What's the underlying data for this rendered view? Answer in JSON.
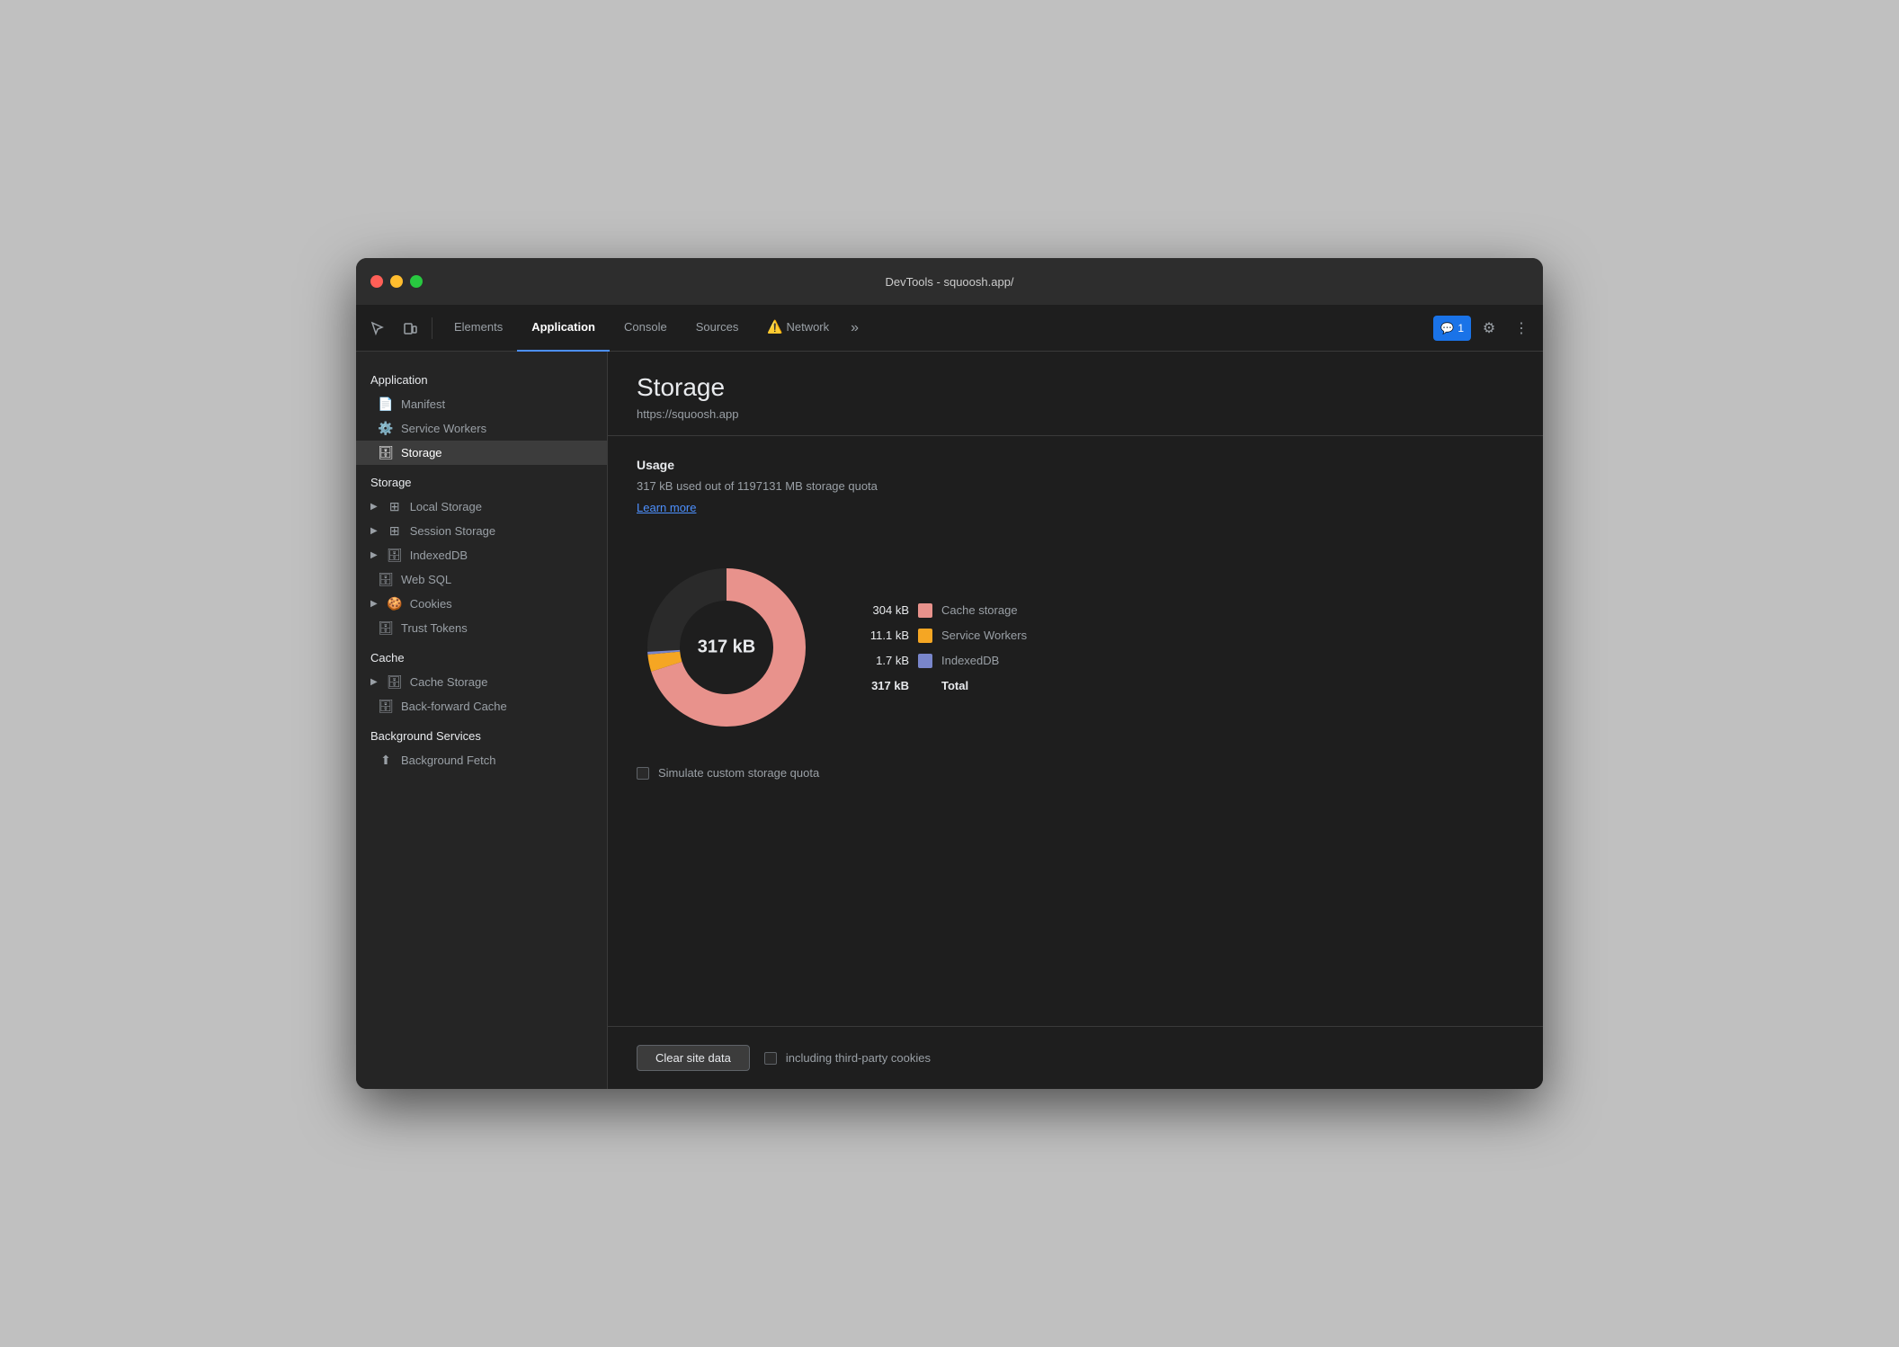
{
  "window": {
    "title": "DevTools - squoosh.app/"
  },
  "toolbar": {
    "tabs": [
      {
        "id": "elements",
        "label": "Elements",
        "active": false
      },
      {
        "id": "application",
        "label": "Application",
        "active": true
      },
      {
        "id": "console",
        "label": "Console",
        "active": false
      },
      {
        "id": "sources",
        "label": "Sources",
        "active": false
      },
      {
        "id": "network",
        "label": "Network",
        "active": false
      }
    ],
    "more_label": "»",
    "notification_count": "1",
    "settings_icon": "⚙",
    "more_icon": "⋮"
  },
  "sidebar": {
    "section_application": "Application",
    "manifest_label": "Manifest",
    "service_workers_label": "Service Workers",
    "storage_label": "Storage",
    "section_storage": "Storage",
    "local_storage_label": "Local Storage",
    "session_storage_label": "Session Storage",
    "indexed_db_label": "IndexedDB",
    "web_sql_label": "Web SQL",
    "cookies_label": "Cookies",
    "trust_tokens_label": "Trust Tokens",
    "section_cache": "Cache",
    "cache_storage_label": "Cache Storage",
    "back_forward_label": "Back-forward Cache",
    "section_background": "Background Services",
    "bg_fetch_label": "Background Fetch"
  },
  "detail": {
    "title": "Storage",
    "url": "https://squoosh.app",
    "usage_title": "Usage",
    "usage_desc": "317 kB used out of 1197131 MB storage quota",
    "learn_more": "Learn more",
    "donut_label": "317 kB",
    "legend": [
      {
        "value": "304 kB",
        "label": "Cache storage",
        "color": "#e8928c"
      },
      {
        "value": "11.1 kB",
        "label": "Service Workers",
        "color": "#f5a623"
      },
      {
        "value": "1.7 kB",
        "label": "IndexedDB",
        "color": "#7986cb"
      }
    ],
    "total_value": "317 kB",
    "total_label": "Total",
    "simulate_label": "Simulate custom storage quota",
    "clear_btn": "Clear site data",
    "third_party_label": "including third-party cookies"
  }
}
